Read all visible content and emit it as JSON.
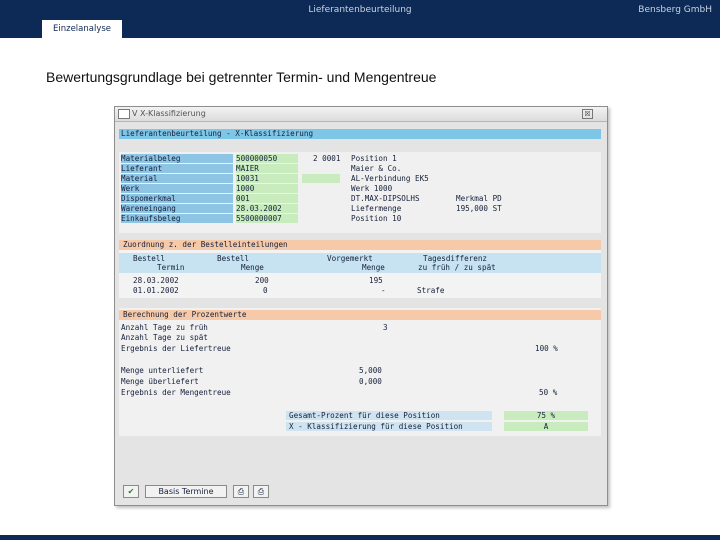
{
  "header": {
    "center_title": "Lieferantenbeurteilung",
    "company": "Bensberg GmbH",
    "section_tab": "Einzelanalyse"
  },
  "slide_title": "Bewertungsgrundlage bei getrennter Termin- und Mengentreue",
  "window": {
    "title": "V  X-Klassifizierung",
    "close_symbol": "☒",
    "headline": "Lieferantenbeurteilung - X-Klassifizierung",
    "info": [
      {
        "label": "Materialbeleg",
        "value": "500000050",
        "extra": "2 0001",
        "right_label": "Position 1",
        "right_value": ""
      },
      {
        "label": "Lieferant",
        "value": "MAIER",
        "extra": "",
        "right_label": "Maier & Co.",
        "right_value": ""
      },
      {
        "label": "Material",
        "value": "10031",
        "extra": "",
        "right_label": "AL-Verbindung EK5",
        "right_value": ""
      },
      {
        "label": "Werk",
        "value": "1000",
        "extra": "",
        "right_label": "Werk 1000",
        "right_value": ""
      },
      {
        "label": "Dispomerkmal",
        "value": "001",
        "extra": "",
        "right_label": "DT.MAX-DIPSOLHS",
        "right_value": "Merkmal PD"
      },
      {
        "label": "Wareneingang",
        "value": "28.03.2002",
        "extra": "",
        "right_label": "Liefermenge",
        "right_value": "195,000 ST"
      },
      {
        "label": "Einkaufsbeleg",
        "value": "5500000007",
        "extra": "",
        "right_label": "Position 10",
        "right_value": ""
      }
    ],
    "zuordnung": {
      "title": "Zuordnung z. der Bestelleinteilungen",
      "columns_top": [
        "Bestell",
        "Bestell",
        "Vorgemerkt",
        "Tagesdifferenz"
      ],
      "columns_bottom": [
        "Termin",
        "Menge",
        "Menge",
        "zu früh / zu spät"
      ],
      "rows": [
        {
          "date": "28.03.2002",
          "qty": "200",
          "gm": "195",
          "diff": ""
        },
        {
          "date": "01.01.2002",
          "qty": "0",
          "gm": "-",
          "diff": "Strafe"
        }
      ]
    },
    "berechnung": {
      "title": "Berechnung der Prozentwerte",
      "rows": [
        {
          "label": "Anzahl Tage zu früh",
          "value": "3",
          "result": ""
        },
        {
          "label": "Anzahl Tage zu spät",
          "value": "",
          "result": ""
        },
        {
          "label": "Ergebnis der Liefertreue",
          "value": "",
          "result": "100 %"
        },
        {
          "label": "Menge unterliefert",
          "value": "5,000",
          "result": ""
        },
        {
          "label": "Menge überliefert",
          "value": "0,000",
          "result": ""
        },
        {
          "label": "Ergebnis der Mengentreue",
          "value": "",
          "result": "50 %"
        }
      ],
      "total_label": "Gesamt-Prozent für diese Position",
      "total_value": "75 %",
      "class_label": "X - Klassifizierung für diese Position",
      "class_value": "A"
    },
    "footer": {
      "ok_symbol": "✔",
      "basis_button": "Basis Termine",
      "save_symbol": "⎙",
      "print_symbol": "⎙"
    }
  }
}
